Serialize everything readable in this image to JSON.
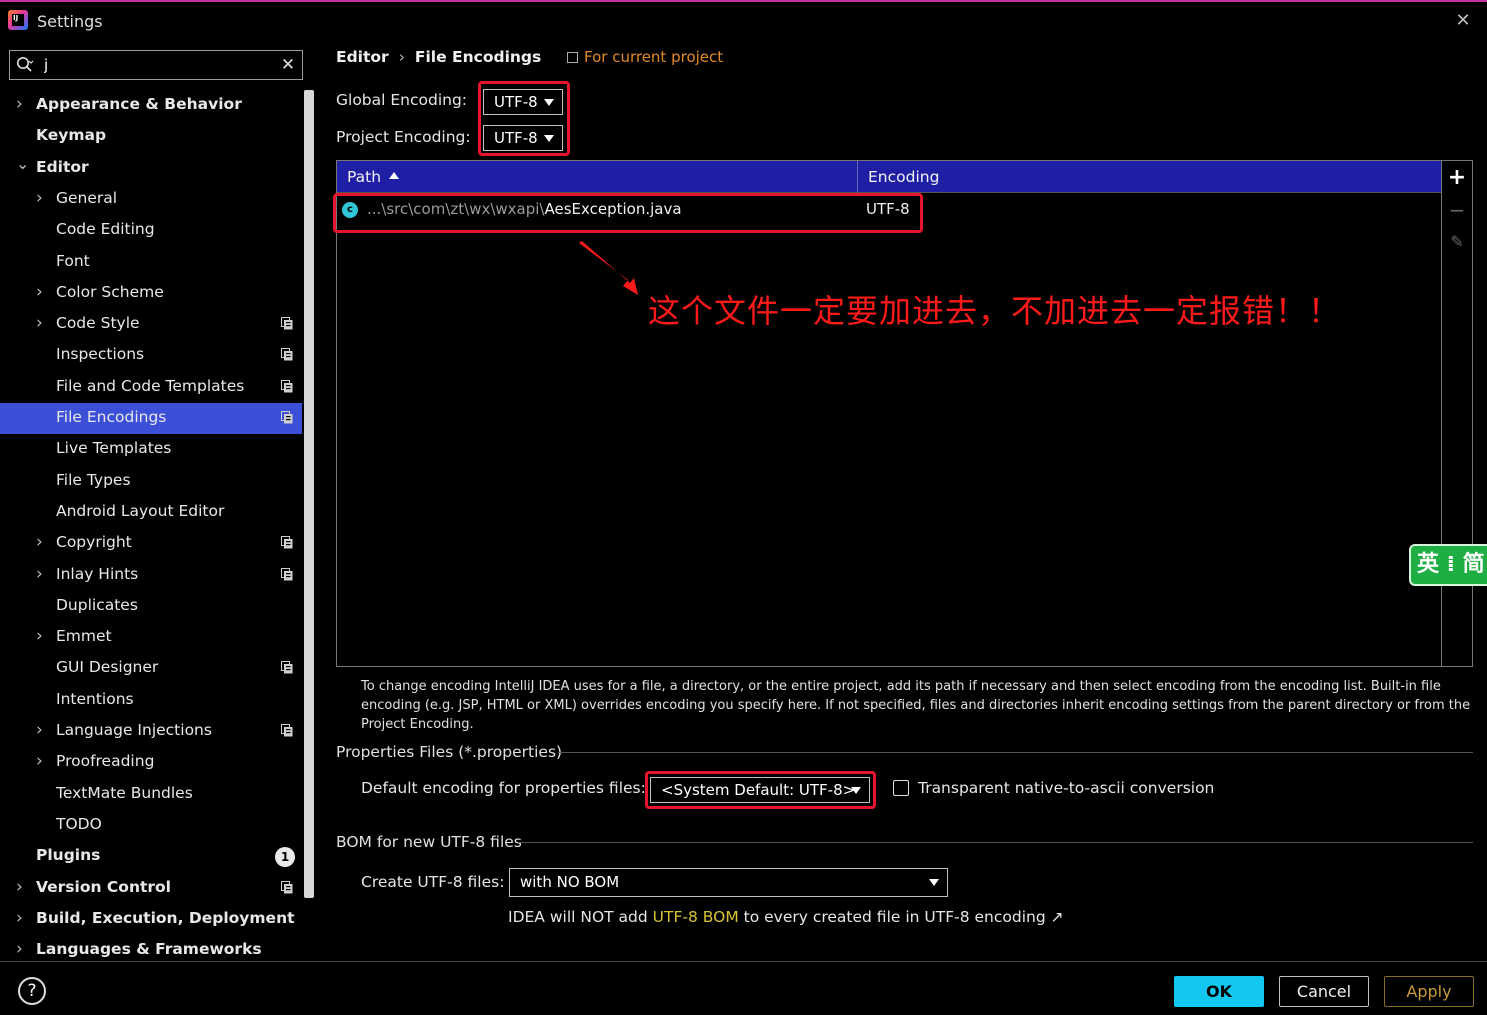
{
  "window": {
    "title": "Settings",
    "close_glyph": "✕"
  },
  "search": {
    "value": "j",
    "clear_glyph": "✕"
  },
  "tree": [
    {
      "label": "Appearance & Behavior",
      "level": 0,
      "bold": true,
      "expandable": true,
      "expanded": false
    },
    {
      "label": "Keymap",
      "level": 0,
      "bold": true,
      "expandable": false
    },
    {
      "label": "Editor",
      "level": 0,
      "bold": true,
      "expandable": true,
      "expanded": true
    },
    {
      "label": "General",
      "level": 1,
      "expandable": true,
      "expanded": false
    },
    {
      "label": "Code Editing",
      "level": 1
    },
    {
      "label": "Font",
      "level": 1
    },
    {
      "label": "Color Scheme",
      "level": 1,
      "expandable": true,
      "expanded": false
    },
    {
      "label": "Code Style",
      "level": 1,
      "expandable": true,
      "expanded": false,
      "project": true
    },
    {
      "label": "Inspections",
      "level": 1,
      "project": true
    },
    {
      "label": "File and Code Templates",
      "level": 1,
      "project": true
    },
    {
      "label": "File Encodings",
      "level": 1,
      "project": true,
      "selected": true
    },
    {
      "label": "Live Templates",
      "level": 1
    },
    {
      "label": "File Types",
      "level": 1
    },
    {
      "label": "Android Layout Editor",
      "level": 1
    },
    {
      "label": "Copyright",
      "level": 1,
      "expandable": true,
      "expanded": false,
      "project": true
    },
    {
      "label": "Inlay Hints",
      "level": 1,
      "expandable": true,
      "expanded": false,
      "project": true
    },
    {
      "label": "Duplicates",
      "level": 1
    },
    {
      "label": "Emmet",
      "level": 1,
      "expandable": true,
      "expanded": false
    },
    {
      "label": "GUI Designer",
      "level": 1,
      "project": true
    },
    {
      "label": "Intentions",
      "level": 1
    },
    {
      "label": "Language Injections",
      "level": 1,
      "expandable": true,
      "expanded": false,
      "project": true
    },
    {
      "label": "Proofreading",
      "level": 1,
      "expandable": true,
      "expanded": false
    },
    {
      "label": "TextMate Bundles",
      "level": 1
    },
    {
      "label": "TODO",
      "level": 1
    },
    {
      "label": "Plugins",
      "level": 0,
      "bold": true,
      "badge": "1"
    },
    {
      "label": "Version Control",
      "level": 0,
      "bold": true,
      "expandable": true,
      "expanded": false,
      "project": true
    },
    {
      "label": "Build, Execution, Deployment",
      "level": 0,
      "bold": true,
      "expandable": true,
      "expanded": false
    },
    {
      "label": "Languages & Frameworks",
      "level": 0,
      "bold": true,
      "expandable": true,
      "expanded": false
    }
  ],
  "breadcrumb": {
    "parent": "Editor",
    "separator": "›",
    "current": "File Encodings"
  },
  "scope_note": "For current project",
  "global_encoding": {
    "label": "Global Encoding:",
    "value": "UTF-8"
  },
  "project_encoding": {
    "label": "Project Encoding:",
    "value": "UTF-8"
  },
  "table": {
    "columns": {
      "path": "Path",
      "encoding": "Encoding"
    },
    "rows": [
      {
        "path_prefix": "...\\src\\com\\zt\\wx\\wxapi\\",
        "file": "AesException.java",
        "encoding": "UTF-8",
        "icon_letter": "c"
      }
    ],
    "toolbar": {
      "add": "+",
      "remove": "−",
      "edit": "✎"
    }
  },
  "annotation": "这个文件一定要加进去，不加进去一定报错！！",
  "ime_badge": "英 ⁞ 简",
  "help_text": "To change encoding IntelliJ IDEA uses for a file, a directory, or the entire project, add its path if necessary and then select encoding from the encoding list. Built-in file encoding (e.g. JSP, HTML or XML) overrides encoding you specify here. If not specified, files and directories inherit encoding settings from the parent directory or from the Project Encoding.",
  "properties": {
    "section_title": "Properties Files (*.properties)",
    "default_label": "Default encoding for properties files:",
    "default_value": "<System Default: UTF-8>",
    "transparent_label": "Transparent native-to-ascii conversion",
    "transparent_checked": false
  },
  "bom": {
    "section_title": "BOM for new UTF-8 files",
    "create_label": "Create UTF-8 files:",
    "create_value": "with NO BOM",
    "hint_prefix": "IDEA will NOT add ",
    "hint_highlight": "UTF-8 BOM",
    "hint_suffix": " to every created file in UTF-8 encoding ↗"
  },
  "buttons": {
    "help": "?",
    "ok": "OK",
    "cancel": "Cancel",
    "apply": "Apply"
  },
  "colors": {
    "selection": "#3c4fd8",
    "table_header": "#1f1fa6",
    "annotation_red": "#e5162b",
    "ok_button": "#12c8f0",
    "scope_orange": "#e08a2a"
  }
}
